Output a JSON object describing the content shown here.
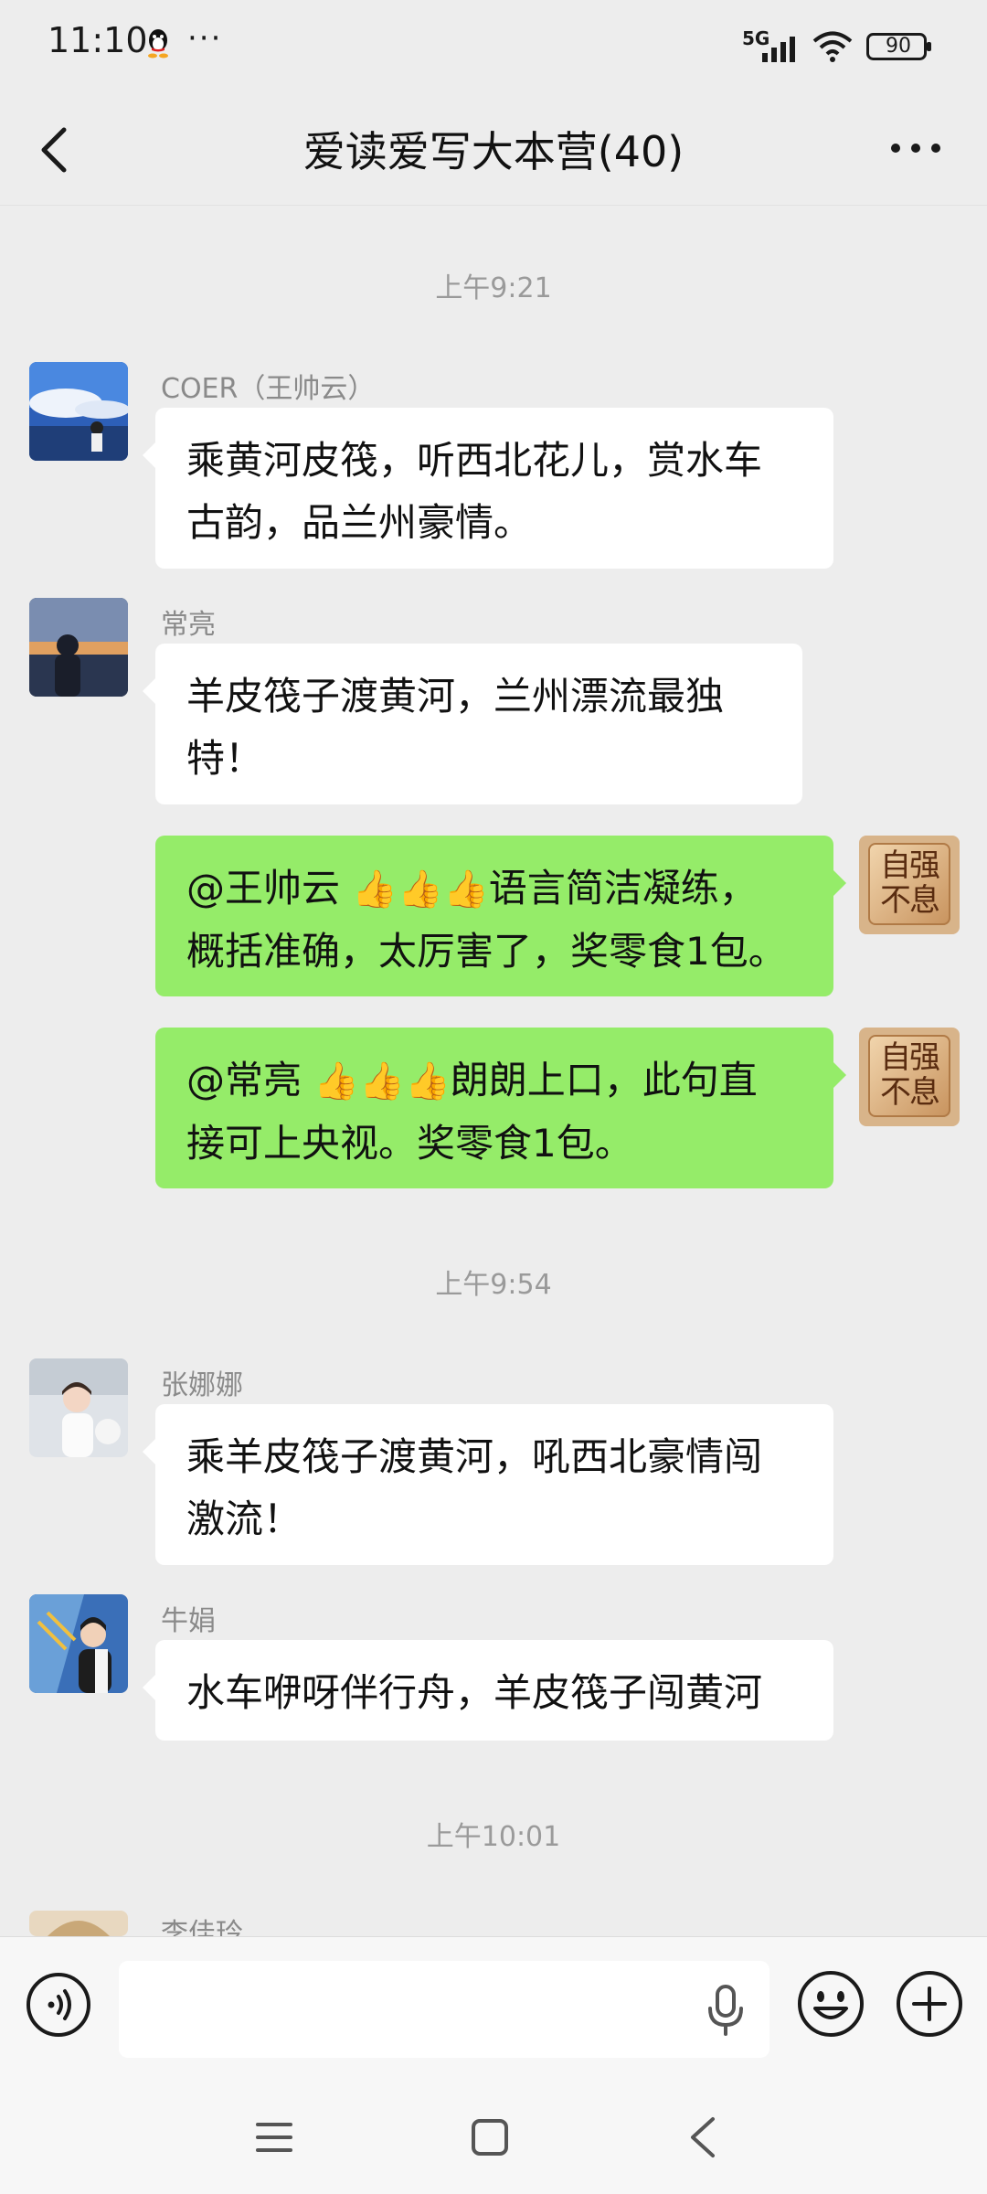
{
  "status_bar": {
    "time": "11:10",
    "more": "···",
    "network": "5G",
    "battery": "90"
  },
  "header": {
    "title": "爱读爱写大本营(40)"
  },
  "messages": [
    {
      "type": "time",
      "text": "上午9:21"
    },
    {
      "type": "in",
      "sender": "COER（王帅云）",
      "lines": [
        "乘黄河皮筏，听西北花儿，赏水车",
        "古韵，品兰州豪情。"
      ]
    },
    {
      "type": "in",
      "sender": "常亮",
      "lines": [
        "羊皮筏子渡黄河，兰州漂流最独",
        "特！"
      ]
    },
    {
      "type": "out",
      "mention": "@王帅云",
      "thumbs": "👍👍👍",
      "lines": [
        "语言简洁凝练，",
        "概括准确，太厉害了，奖零食1包。"
      ]
    },
    {
      "type": "out",
      "mention": "@常亮",
      "thumbs": "👍👍👍",
      "lines": [
        "朗朗上口，此句直",
        "接可上央视。奖零食1包。"
      ]
    },
    {
      "type": "time",
      "text": "上午9:54"
    },
    {
      "type": "in",
      "sender": "张娜娜",
      "lines": [
        "乘羊皮筏子渡黄河，吼西北豪情闯",
        "激流！"
      ]
    },
    {
      "type": "in",
      "sender": "牛娟",
      "lines": [
        "水车咿呀伴行舟，羊皮筏子闯黄河"
      ]
    },
    {
      "type": "time",
      "text": "上午10:01"
    },
    {
      "type": "in",
      "sender": "李佳玲",
      "lines": []
    }
  ],
  "self_avatar_text": "自强不息",
  "input": {
    "placeholder": ""
  },
  "colors": {
    "out_bubble": "#95ec69",
    "in_bubble": "#ffffff",
    "background": "#ededed"
  }
}
